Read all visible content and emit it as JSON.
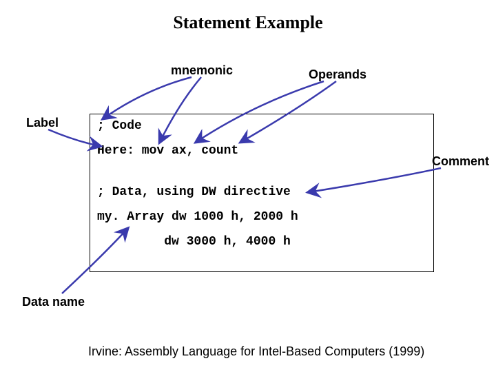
{
  "title": "Statement Example",
  "annotations": {
    "mnemonic": "mnemonic",
    "operands": "Operands",
    "label": "Label",
    "comment": "Comment",
    "data_name": "Data name"
  },
  "code": {
    "l1": "; Code",
    "l2": "Here: mov ax, count",
    "l3": "; Data, using DW directive",
    "l4": "my. Array dw 1000 h, 2000 h",
    "l5": "         dw 3000 h, 4000 h"
  },
  "citation": "Irvine: Assembly Language for Intel-Based Computers (1999)"
}
